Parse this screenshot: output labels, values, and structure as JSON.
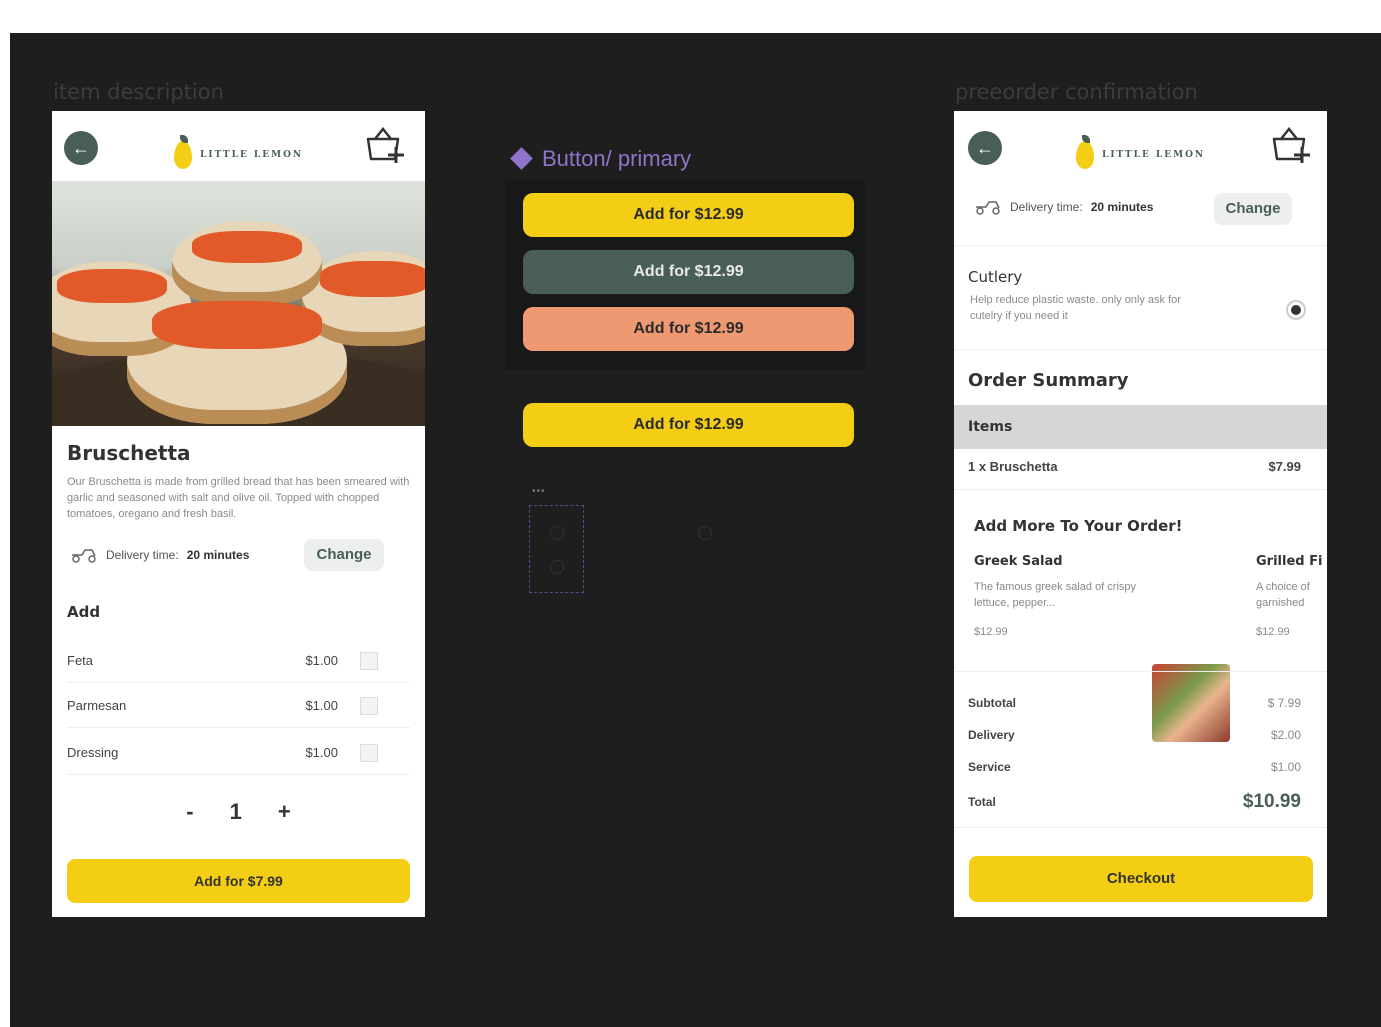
{
  "left_frame": {
    "label": "item description",
    "logo_text": "LITTLE LEMON",
    "product_title": "Bruschetta",
    "description": "Our Bruschetta is made from grilled bread that has been smeared with garlic and seasoned with salt and olive oil. Topped with chopped tomatoes, oregano and fresh basil.",
    "delivery_label": "Delivery time:",
    "delivery_value": "20 minutes",
    "change_label": "Change",
    "add_heading": "Add",
    "addons": [
      {
        "name": "Feta",
        "price": "$1.00"
      },
      {
        "name": "Parmesan",
        "price": "$1.00"
      },
      {
        "name": "Dressing",
        "price": "$1.00"
      }
    ],
    "quantity": {
      "minus": "-",
      "value": "1",
      "plus": "+"
    },
    "add_button": "Add for $7.99"
  },
  "component": {
    "title": "Button/ primary",
    "variants": [
      {
        "label": "Add for $12.99",
        "color": "#f4ce14"
      },
      {
        "label": "Add for $12.99",
        "color": "#495e57"
      },
      {
        "label": "Add for $12.99",
        "color": "#ee9972"
      }
    ],
    "instance_label": "Add for $12.99",
    "handle_dots": "•••"
  },
  "right_frame": {
    "label": "preeorder confirmation",
    "logo_text": "LITTLE LEMON",
    "delivery_label": "Delivery time:",
    "delivery_value": "20 minutes",
    "change_label": "Change",
    "cutlery_title": "Cutlery",
    "cutlery_text": "Help reduce plastic waste. only only ask for cutelry if you need it",
    "summary_title": "Order Summary",
    "items_header": "Items",
    "line_item_name": "1 x Bruschetta",
    "line_item_price": "$7.99",
    "add_more_title": "Add More To Your Order!",
    "suggestion_1_name": "Greek Salad",
    "suggestion_1_desc": "The famous greek salad of crispy lettuce, pepper...",
    "suggestion_1_price": "$12.99",
    "suggestion_2_name": "Grilled Fi",
    "suggestion_2_desc": "A choice of garnished",
    "suggestion_2_price": "$12.99",
    "subtotal_label": "Subtotal",
    "subtotal_value": "$ 7.99",
    "delivery_fee_label": "Delivery",
    "delivery_fee_value": "$2.00",
    "service_label": "Service",
    "service_value": "$1.00",
    "total_label": "Total",
    "total_value": "$10.99",
    "checkout_label": "Checkout"
  },
  "colors": {
    "primary_yellow": "#f4ce14",
    "primary_green": "#495e57",
    "salmon": "#ee9972",
    "canvas": "#1e1e1e"
  }
}
